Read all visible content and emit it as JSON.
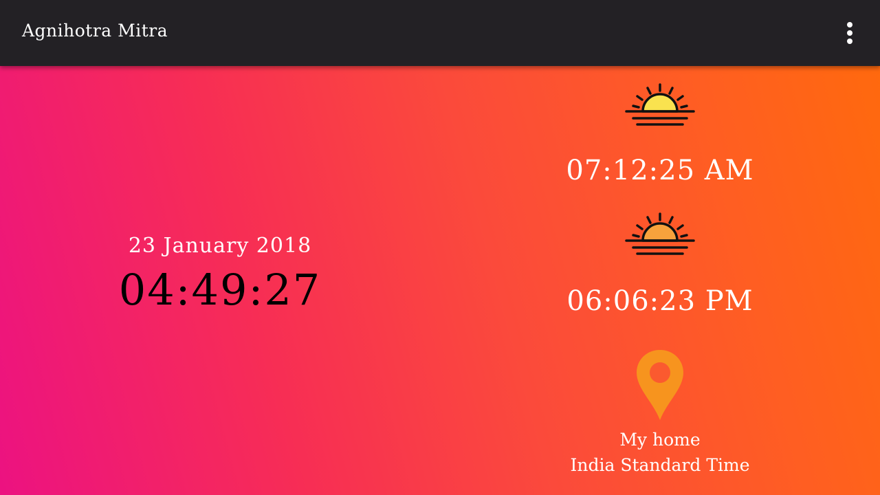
{
  "app_bar": {
    "title": "Agnihotra Mitra",
    "menu_icon": "more-vert-icon"
  },
  "current": {
    "date": "23 January 2018",
    "time": "04:49:27"
  },
  "sunrise": {
    "icon": "sunrise-icon",
    "time": "07:12:25 AM",
    "sun_color": "#f9e24f"
  },
  "sunset": {
    "icon": "sunset-icon",
    "time": "06:06:23 PM",
    "sun_color": "#f7a23c"
  },
  "location": {
    "icon": "location-pin-icon",
    "name": "My home",
    "timezone": "India Standard Time",
    "pin_color": "#f7941e"
  },
  "colors": {
    "toolbar": "#232125",
    "gradient_start": "#ec1281",
    "gradient_end": "#ff6a0c"
  }
}
